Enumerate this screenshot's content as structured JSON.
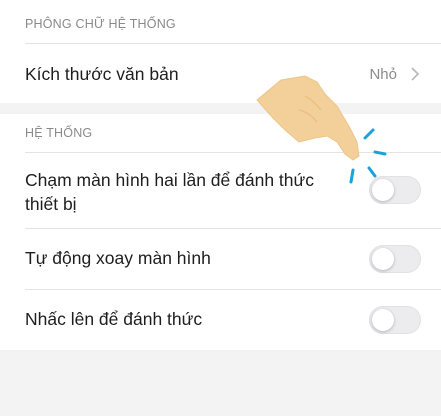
{
  "colors": {
    "page_background": "#f3f3f4",
    "panel_background": "#ffffff",
    "section_header": "#8a8a8a",
    "toggle_off": "#ececef",
    "hand": "#f3cf9a",
    "tap_marks": "#1aa3d8"
  },
  "font_section": {
    "header": "PHÔNG CHỮ HỆ THỐNG",
    "rows": [
      {
        "label": "Kích thước văn bản",
        "value": "Nhỏ",
        "icon": "chevron-right-icon"
      }
    ]
  },
  "system_section": {
    "header": "HỆ THỐNG",
    "rows": [
      {
        "label_line1": "Chạm màn hình hai lần để đánh thức",
        "label_line2": "thiết bị",
        "toggle_on": false
      },
      {
        "label": "Tự động xoay màn hình",
        "toggle_on": false
      },
      {
        "label": "Nhấc lên để đánh thức",
        "toggle_on": false
      }
    ]
  },
  "overlay": {
    "icon": "tap-hand-icon"
  }
}
